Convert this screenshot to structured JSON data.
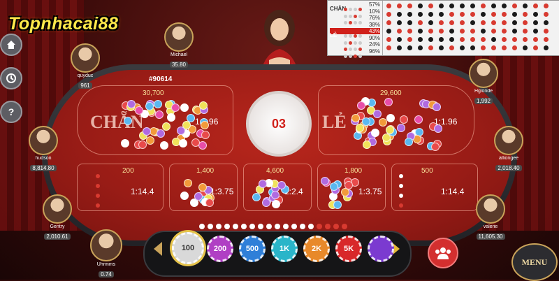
{
  "logo": {
    "text": "Topnhacai88"
  },
  "side_buttons": [
    "home-icon",
    "history-icon",
    "help-icon"
  ],
  "table": {
    "id": "#90614",
    "result": "03",
    "big_bets": [
      {
        "word": "CHẴN",
        "amount": "30,700",
        "ratio": "1:1.96"
      },
      {
        "word": "LẺ",
        "amount": "29,600",
        "ratio": "1:1.96"
      }
    ],
    "small_bets": [
      {
        "amount": "200",
        "ratio": "1:14.4"
      },
      {
        "amount": "1,400",
        "ratio": "1:3.75"
      },
      {
        "amount": "4,600",
        "ratio": "1:2.4"
      },
      {
        "amount": "1,800",
        "ratio": "1:3.75"
      },
      {
        "amount": "500",
        "ratio": "1:14.4"
      }
    ]
  },
  "history": {
    "rows": [
      {
        "label": "CHẴN",
        "pct": "57%"
      },
      {
        "label": "",
        "pct": "10%"
      },
      {
        "label": "",
        "pct": "76%"
      },
      {
        "label": "",
        "pct": "38%"
      },
      {
        "label": "LẺ",
        "pct": "43%"
      },
      {
        "label": "",
        "pct": "90%"
      },
      {
        "label": "",
        "pct": "24%"
      },
      {
        "label": "",
        "pct": "96%"
      }
    ]
  },
  "players": [
    {
      "name": "Michael",
      "money": "35.80"
    },
    {
      "name": "quyduc",
      "money": "961"
    },
    {
      "name": "hudson",
      "money": "8,814.80"
    },
    {
      "name": "Gentry",
      "money": "2,010.61"
    },
    {
      "name": "Uhrmms",
      "money": "0.74"
    },
    {
      "name": "Hglonde",
      "money": "1,992"
    },
    {
      "name": "alliongee",
      "money": "2,018.40"
    },
    {
      "name": "valerie",
      "money": "11,605.30"
    }
  ],
  "chips": [
    {
      "label": "100",
      "color": "#d9d9d9"
    },
    {
      "label": "200",
      "color": "#b03fc4"
    },
    {
      "label": "500",
      "color": "#2f7fd8"
    },
    {
      "label": "1K",
      "color": "#2ab5c9"
    },
    {
      "label": "2K",
      "color": "#e8892a"
    },
    {
      "label": "5K",
      "color": "#d8282a"
    },
    {
      "label": "",
      "color": "#7b3ad0"
    }
  ],
  "menu_label": "MENU",
  "colors": {
    "felt": "#a8201a",
    "accent": "#c9a35a",
    "result_text": "#d0201a"
  }
}
